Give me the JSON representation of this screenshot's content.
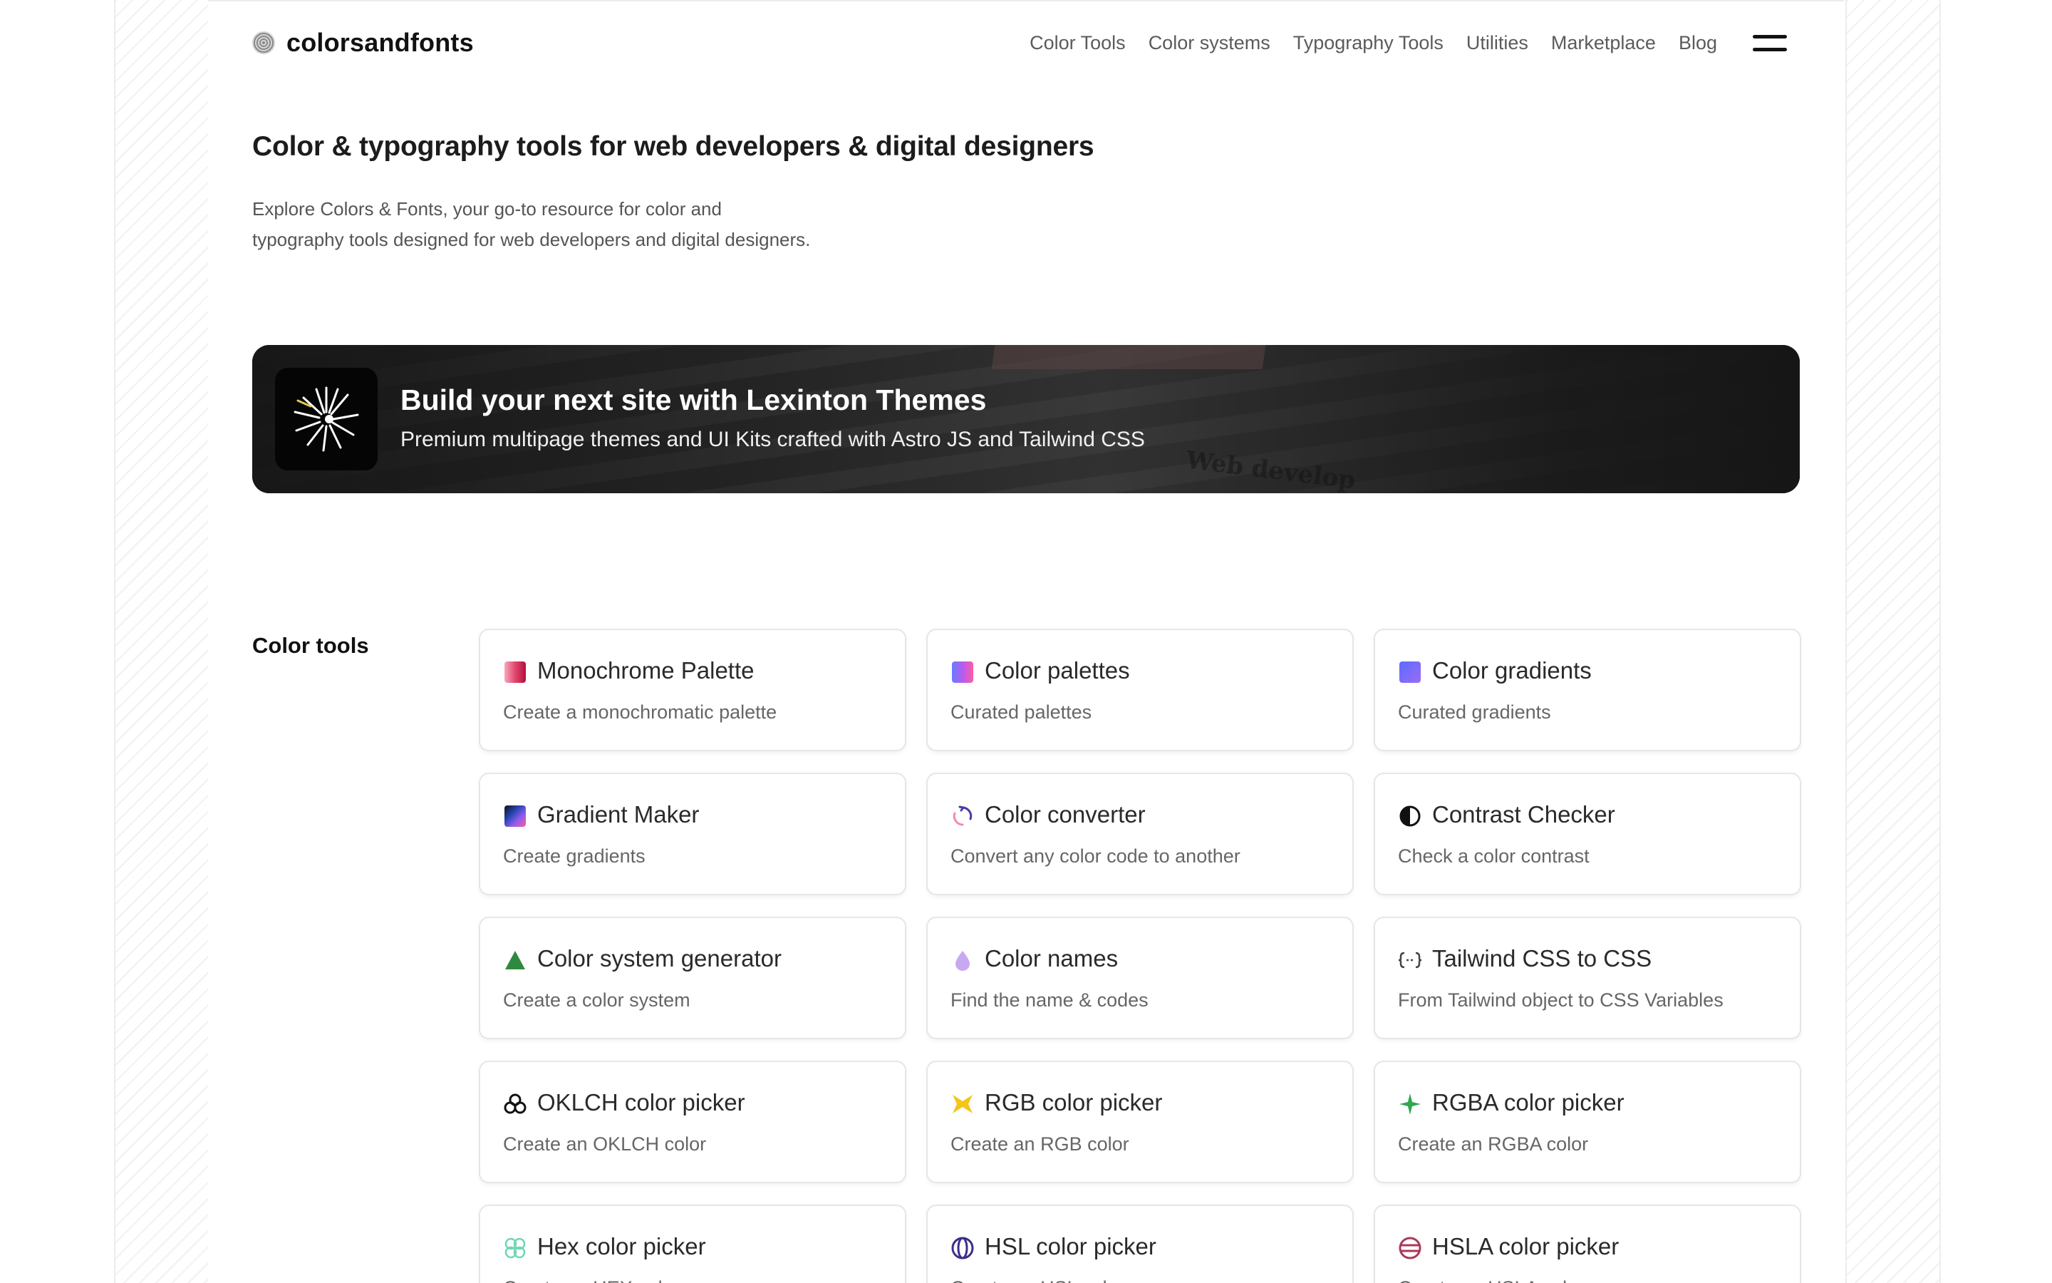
{
  "logo": {
    "text": "colorsandfonts",
    "icon": "fingerprint-logo-icon"
  },
  "nav": {
    "links": [
      "Color Tools",
      "Color systems",
      "Typography Tools",
      "Utilities",
      "Marketplace",
      "Blog"
    ],
    "menu_icon": "hamburger-menu-icon"
  },
  "hero": {
    "title": "Color & typography tools for web developers & digital designers",
    "description_line1": "Explore Colors & Fonts, your go-to resource for color and",
    "description_line2": "typography tools designed for web developers and digital designers."
  },
  "banner": {
    "title": "Build your next site with Lexinton Themes",
    "subtitle": "Premium multipage themes and UI Kits crafted with Astro JS and Tailwind CSS",
    "background_text": "Web develop",
    "icon": "starburst-logo-icon"
  },
  "color_tools": {
    "label": "Color tools",
    "cards": [
      {
        "title": "Monochrome Palette",
        "desc": "Create a monochromatic palette",
        "icon": "monochrome-gradient-icon"
      },
      {
        "title": "Color palettes",
        "desc": "Curated palettes",
        "icon": "palette-gradient-icon"
      },
      {
        "title": "Color gradients",
        "desc": "Curated gradients",
        "icon": "gradient-square-icon"
      },
      {
        "title": "Gradient Maker",
        "desc": "Create gradients",
        "icon": "gradient-maker-icon"
      },
      {
        "title": "Color converter",
        "desc": "Convert any color code to another",
        "icon": "refresh-arrows-icon"
      },
      {
        "title": "Contrast Checker",
        "desc": "Check a color contrast",
        "icon": "contrast-circle-icon"
      },
      {
        "title": "Color system generator",
        "desc": "Create a color system",
        "icon": "green-triangle-icon"
      },
      {
        "title": "Color names",
        "desc": "Find the name & codes",
        "icon": "droplet-icon"
      },
      {
        "title": "Tailwind CSS to CSS",
        "desc": "From Tailwind object to CSS Variables",
        "icon": "code-braces-icon"
      },
      {
        "title": "OKLCH color picker",
        "desc": "Create an OKLCH color",
        "icon": "trefoil-icon"
      },
      {
        "title": "RGB color picker",
        "desc": "Create an RGB color",
        "icon": "yellow-bowtie-icon"
      },
      {
        "title": "RGBA color picker",
        "desc": "Create an RGBA color",
        "icon": "green-sparkle-icon"
      },
      {
        "title": "Hex color picker",
        "desc": "Create an HEX color",
        "icon": "clover-outline-icon"
      },
      {
        "title": "HSL color picker",
        "desc": "Create an HSL color",
        "icon": "striped-circle-icon"
      },
      {
        "title": "HSLA color picker",
        "desc": "Create an HSLA color",
        "icon": "striped-ball-icon"
      }
    ]
  },
  "colors": {
    "text_primary": "#111111",
    "text_muted": "#5b5b5b",
    "card_border": "#e6e6e6",
    "banner_bg": "#1b1b1b"
  }
}
